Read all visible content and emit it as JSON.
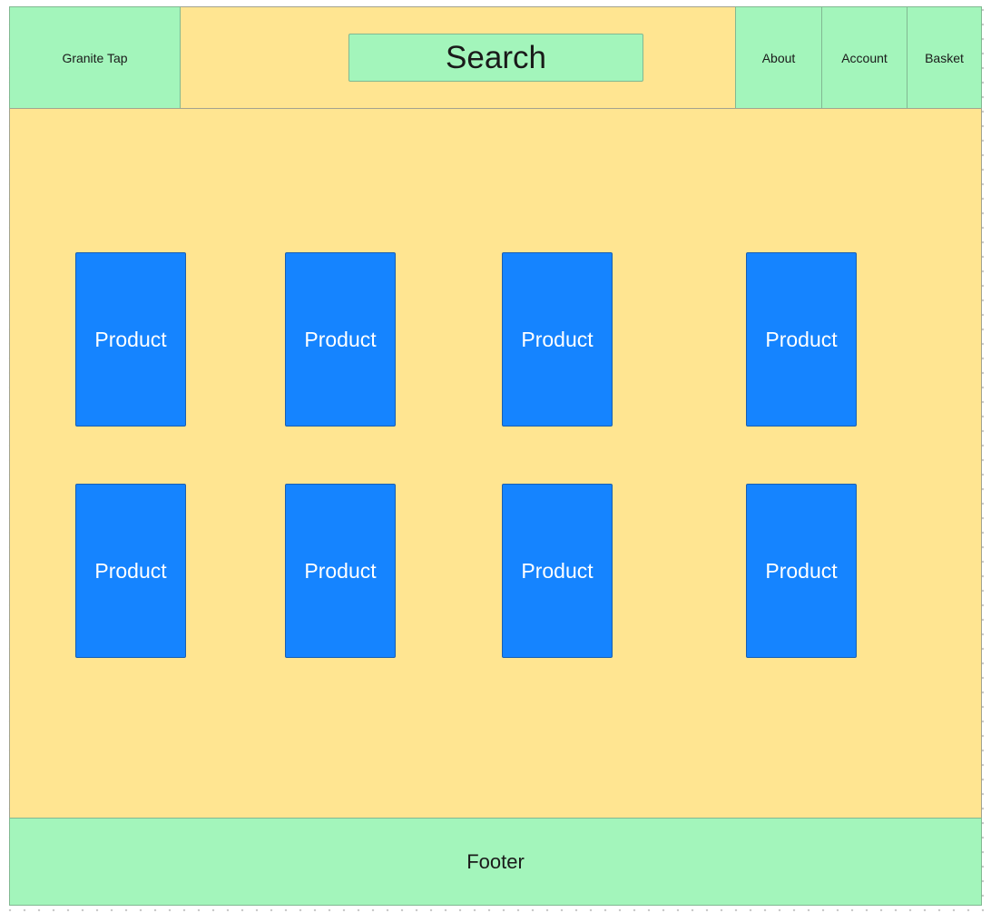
{
  "header": {
    "brand": "Granite Tap",
    "search": "Search",
    "nav": {
      "about": "About",
      "account": "Account",
      "basket": "Basket"
    }
  },
  "products": [
    "Product",
    "Product",
    "Product",
    "Product",
    "Product",
    "Product",
    "Product",
    "Product"
  ],
  "footer": "Footer",
  "colors": {
    "green": "#a3f5bb",
    "yellow": "#ffe591",
    "blue": "#1584ff"
  }
}
